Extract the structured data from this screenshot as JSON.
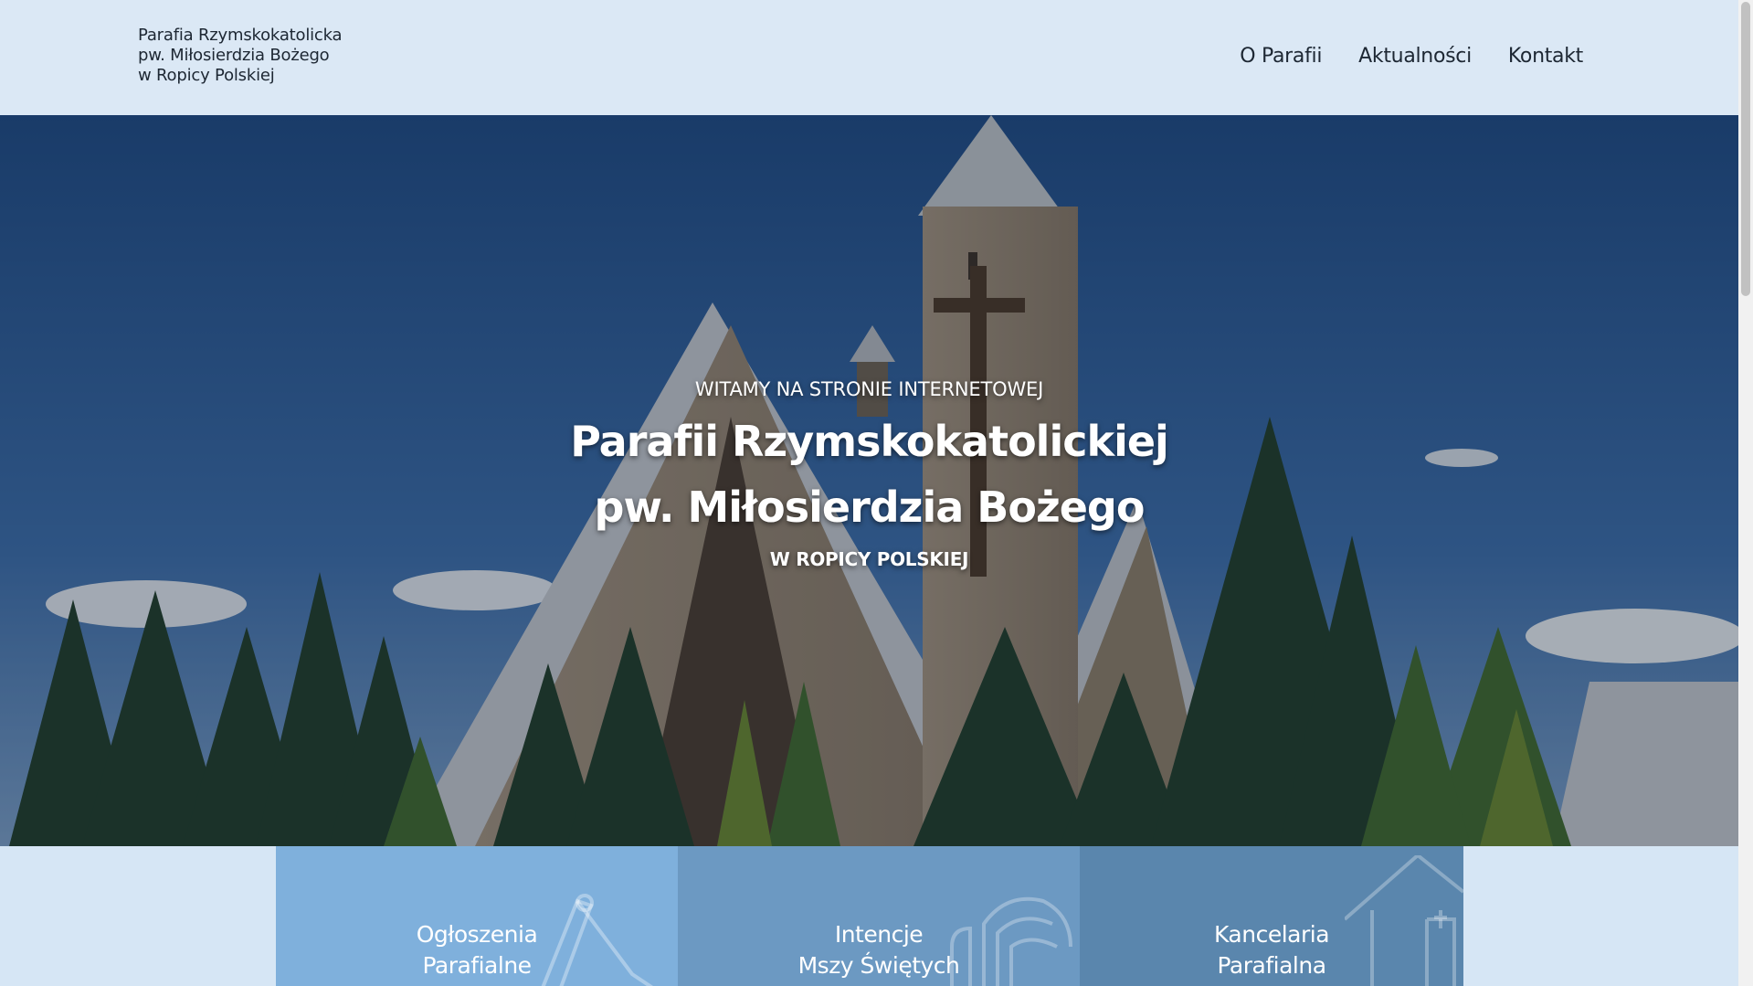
{
  "header": {
    "logo_lines": [
      "Parafia Rzymskokatolicka",
      "pw. Miłosierdzia Bożego",
      "w Ropicy Polskiej"
    ],
    "nav": [
      {
        "label": "O Parafii"
      },
      {
        "label": "Aktualności"
      },
      {
        "label": "Kontakt"
      }
    ]
  },
  "hero": {
    "kicker": "WITAMY NA STRONIE INTERNETOWEJ",
    "title_line1": "Parafii Rzymskokatolickiej",
    "title_line2": "pw. Miłosierdzia Bożego",
    "subtitle": "W ROPICY POLSKIEJ",
    "image_description_icon": "church-photo"
  },
  "tiles": [
    {
      "line1": "Ogłoszenia",
      "line2": "Parafialne",
      "icon": "pencil-icon"
    },
    {
      "line1": "Intencje",
      "line2": "Mszy Świętych",
      "icon": "praying-icon"
    },
    {
      "line1": "Kancelaria",
      "line2": "Parafialna",
      "icon": "church-house-icon"
    }
  ],
  "colors": {
    "header_bg": "#dbe8f5",
    "tile1": "#7fb0dc",
    "tile2": "#6c99c2",
    "tile3": "#5a86ad"
  }
}
